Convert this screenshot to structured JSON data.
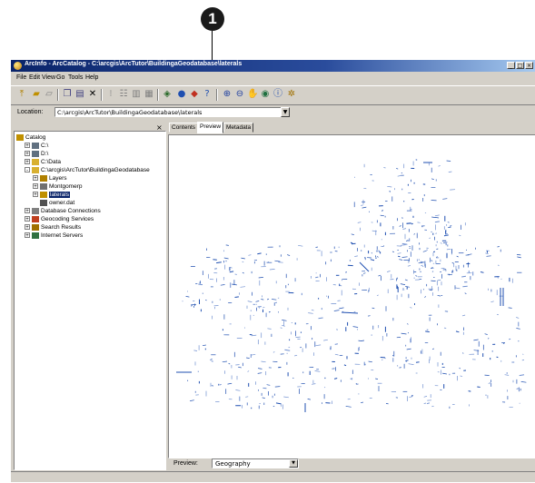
{
  "callout": {
    "number": "1"
  },
  "window": {
    "title": "ArcInfo - ArcCatalog - C:\\arcgis\\ArcTutor\\BuildingaGeodatabase\\laterals",
    "controls": [
      "_",
      "□",
      "×"
    ]
  },
  "menu": [
    "File",
    "Edit",
    "View",
    "Go",
    "Tools",
    "Help"
  ],
  "toolbar": {
    "icons": [
      "up-one-level-icon",
      "connect-folder-icon",
      "disconnect-folder-icon",
      "copy-icon",
      "paste-icon",
      "delete-icon",
      "large-icons-icon",
      "list-icon",
      "details-icon",
      "thumbnails-icon",
      "launch-arcmap-icon",
      "metadata-icon",
      "arctoolbox-icon",
      "whats-this-icon",
      "zoom-in-icon",
      "zoom-out-icon",
      "pan-icon",
      "full-extent-icon",
      "identify-icon",
      "create-thumbnail-icon"
    ]
  },
  "location": {
    "label": "Location:",
    "value": "C:\\arcgis\\ArcTutor\\BuildingaGeodatabase\\laterals"
  },
  "tree": [
    {
      "label": "Catalog",
      "level": 0,
      "expander": "",
      "icon": "catalog"
    },
    {
      "label": "C:\\",
      "level": 1,
      "expander": "+",
      "icon": "drive"
    },
    {
      "label": "D:\\",
      "level": 1,
      "expander": "+",
      "icon": "drive"
    },
    {
      "label": "C:\\Data",
      "level": 1,
      "expander": "+",
      "icon": "folder"
    },
    {
      "label": "C:\\arcgis\\ArcTutor\\BuildingaGeodatabase",
      "level": 1,
      "expander": "-",
      "icon": "folder"
    },
    {
      "label": "Layers",
      "level": 2,
      "expander": "+",
      "icon": "layers"
    },
    {
      "label": "Montgomerp",
      "level": 2,
      "expander": "+",
      "icon": "geodatabase"
    },
    {
      "label": "laterals",
      "level": 2,
      "expander": "+",
      "icon": "coverage",
      "selected": true
    },
    {
      "label": "owner.dat",
      "level": 2,
      "expander": "",
      "icon": "table"
    },
    {
      "label": "Database Connections",
      "level": 1,
      "expander": "+",
      "icon": "database"
    },
    {
      "label": "Geocoding Services",
      "level": 1,
      "expander": "+",
      "icon": "geocoding"
    },
    {
      "label": "Search Results",
      "level": 1,
      "expander": "+",
      "icon": "search"
    },
    {
      "label": "Internet Servers",
      "level": 1,
      "expander": "+",
      "icon": "server"
    }
  ],
  "tabs": [
    "Contents",
    "Preview",
    "Metadata"
  ],
  "active_tab": "Preview",
  "preview": {
    "label": "Preview:",
    "value": "Geography"
  },
  "colors": {
    "titlebar": "#0a246a",
    "features": "#1f4fb0",
    "features_light": "#6f8fd0",
    "chrome": "#d4d0c8"
  }
}
